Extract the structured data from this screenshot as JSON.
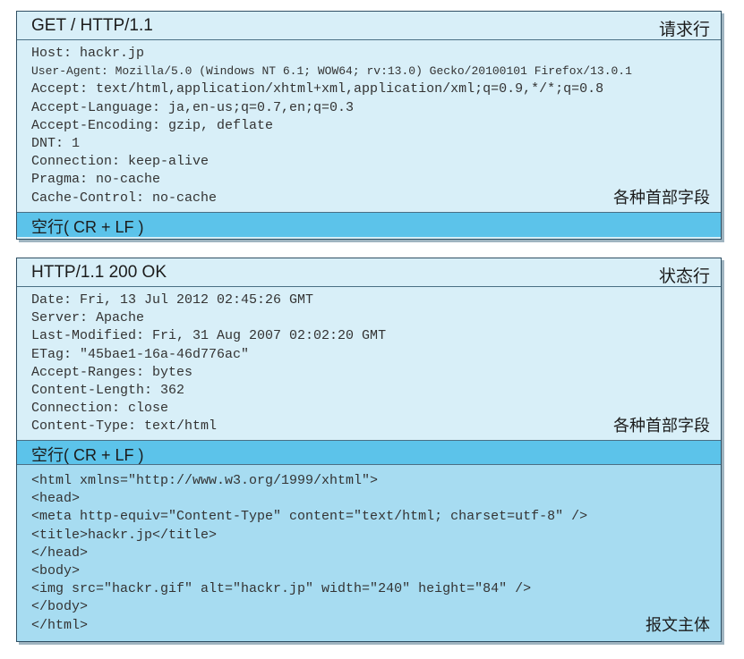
{
  "request": {
    "request_line": "GET / HTTP/1.1",
    "request_line_label": "请求行",
    "headers": [
      "Host: hackr.jp",
      "User-Agent: Mozilla/5.0 (Windows NT 6.1; WOW64; rv:13.0) Gecko/20100101 Firefox/13.0.1",
      "Accept: text/html,application/xhtml+xml,application/xml;q=0.9,*/*;q=0.8",
      "Accept-Language: ja,en-us;q=0.7,en;q=0.3",
      "Accept-Encoding: gzip, deflate",
      "DNT: 1",
      "Connection: keep-alive",
      "Pragma: no-cache",
      "Cache-Control: no-cache"
    ],
    "headers_label": "各种首部字段",
    "blank_line": "空行( CR + LF )"
  },
  "response": {
    "status_line": "HTTP/1.1 200 OK",
    "status_line_label": "状态行",
    "headers": [
      "Date: Fri, 13 Jul 2012 02:45:26 GMT",
      "Server: Apache",
      "Last-Modified: Fri, 31 Aug 2007 02:02:20 GMT",
      "ETag: \"45bae1-16a-46d776ac\"",
      "Accept-Ranges: bytes",
      "Content-Length: 362",
      "Connection: close",
      "Content-Type: text/html"
    ],
    "headers_label": "各种首部字段",
    "blank_line": "空行( CR + LF )",
    "body": [
      "<html xmlns=\"http://www.w3.org/1999/xhtml\">",
      "<head>",
      "<meta http-equiv=\"Content-Type\" content=\"text/html; charset=utf-8\" />",
      "<title>hackr.jp</title>",
      "</head>",
      "<body>",
      "<img src=\"hackr.gif\" alt=\"hackr.jp\" width=\"240\" height=\"84\" />",
      "</body>",
      "</html>"
    ],
    "body_label": "报文主体"
  }
}
